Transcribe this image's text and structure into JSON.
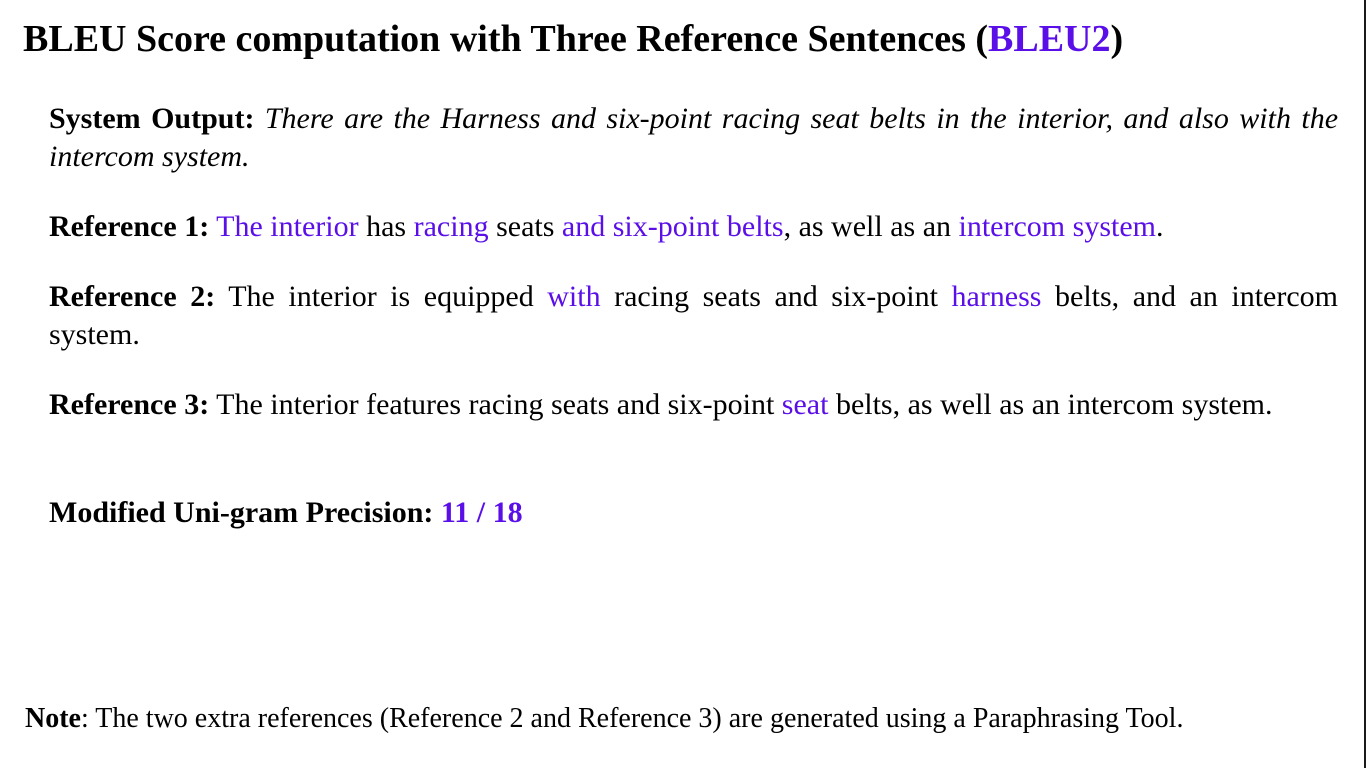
{
  "title": {
    "prefix": "BLEU Score computation with Three Reference Sentences (",
    "highlight": "BLEU2",
    "suffix": ")"
  },
  "system_output": {
    "label": "System Output:",
    "text": "There are the Harness and six-point racing seat belts in the interior, and also with the intercom system."
  },
  "reference1": {
    "label": "Reference 1:",
    "segments": [
      {
        "text": "The interior",
        "match": true
      },
      {
        "text": " has ",
        "match": false
      },
      {
        "text": "racing",
        "match": true
      },
      {
        "text": " seats ",
        "match": false
      },
      {
        "text": "and six-point belts",
        "match": true
      },
      {
        "text": ", as well as an ",
        "match": false
      },
      {
        "text": "intercom system",
        "match": true
      },
      {
        "text": ".",
        "match": false
      }
    ]
  },
  "reference2": {
    "label": "Reference 2:",
    "segments": [
      {
        "text": "The interior is equipped ",
        "match": false
      },
      {
        "text": "with",
        "match": true
      },
      {
        "text": " racing seats and six-point ",
        "match": false
      },
      {
        "text": "harness",
        "match": true
      },
      {
        "text": " belts, and an intercom system.",
        "match": false
      }
    ]
  },
  "reference3": {
    "label": "Reference 3:",
    "segments": [
      {
        "text": "The interior features racing seats and six-point ",
        "match": false
      },
      {
        "text": "seat",
        "match": true
      },
      {
        "text": " belts, as well as an intercom system.",
        "match": false
      }
    ]
  },
  "precision": {
    "label": "Modified Uni-gram Precision:",
    "value": "11 / 18"
  },
  "note": {
    "label": "Note",
    "text": ": The two extra references (Reference 2 and Reference 3) are generated using a Paraphrasing Tool."
  },
  "colors": {
    "highlight": "#5a0fe8",
    "text": "#000000",
    "background": "#ffffff"
  }
}
